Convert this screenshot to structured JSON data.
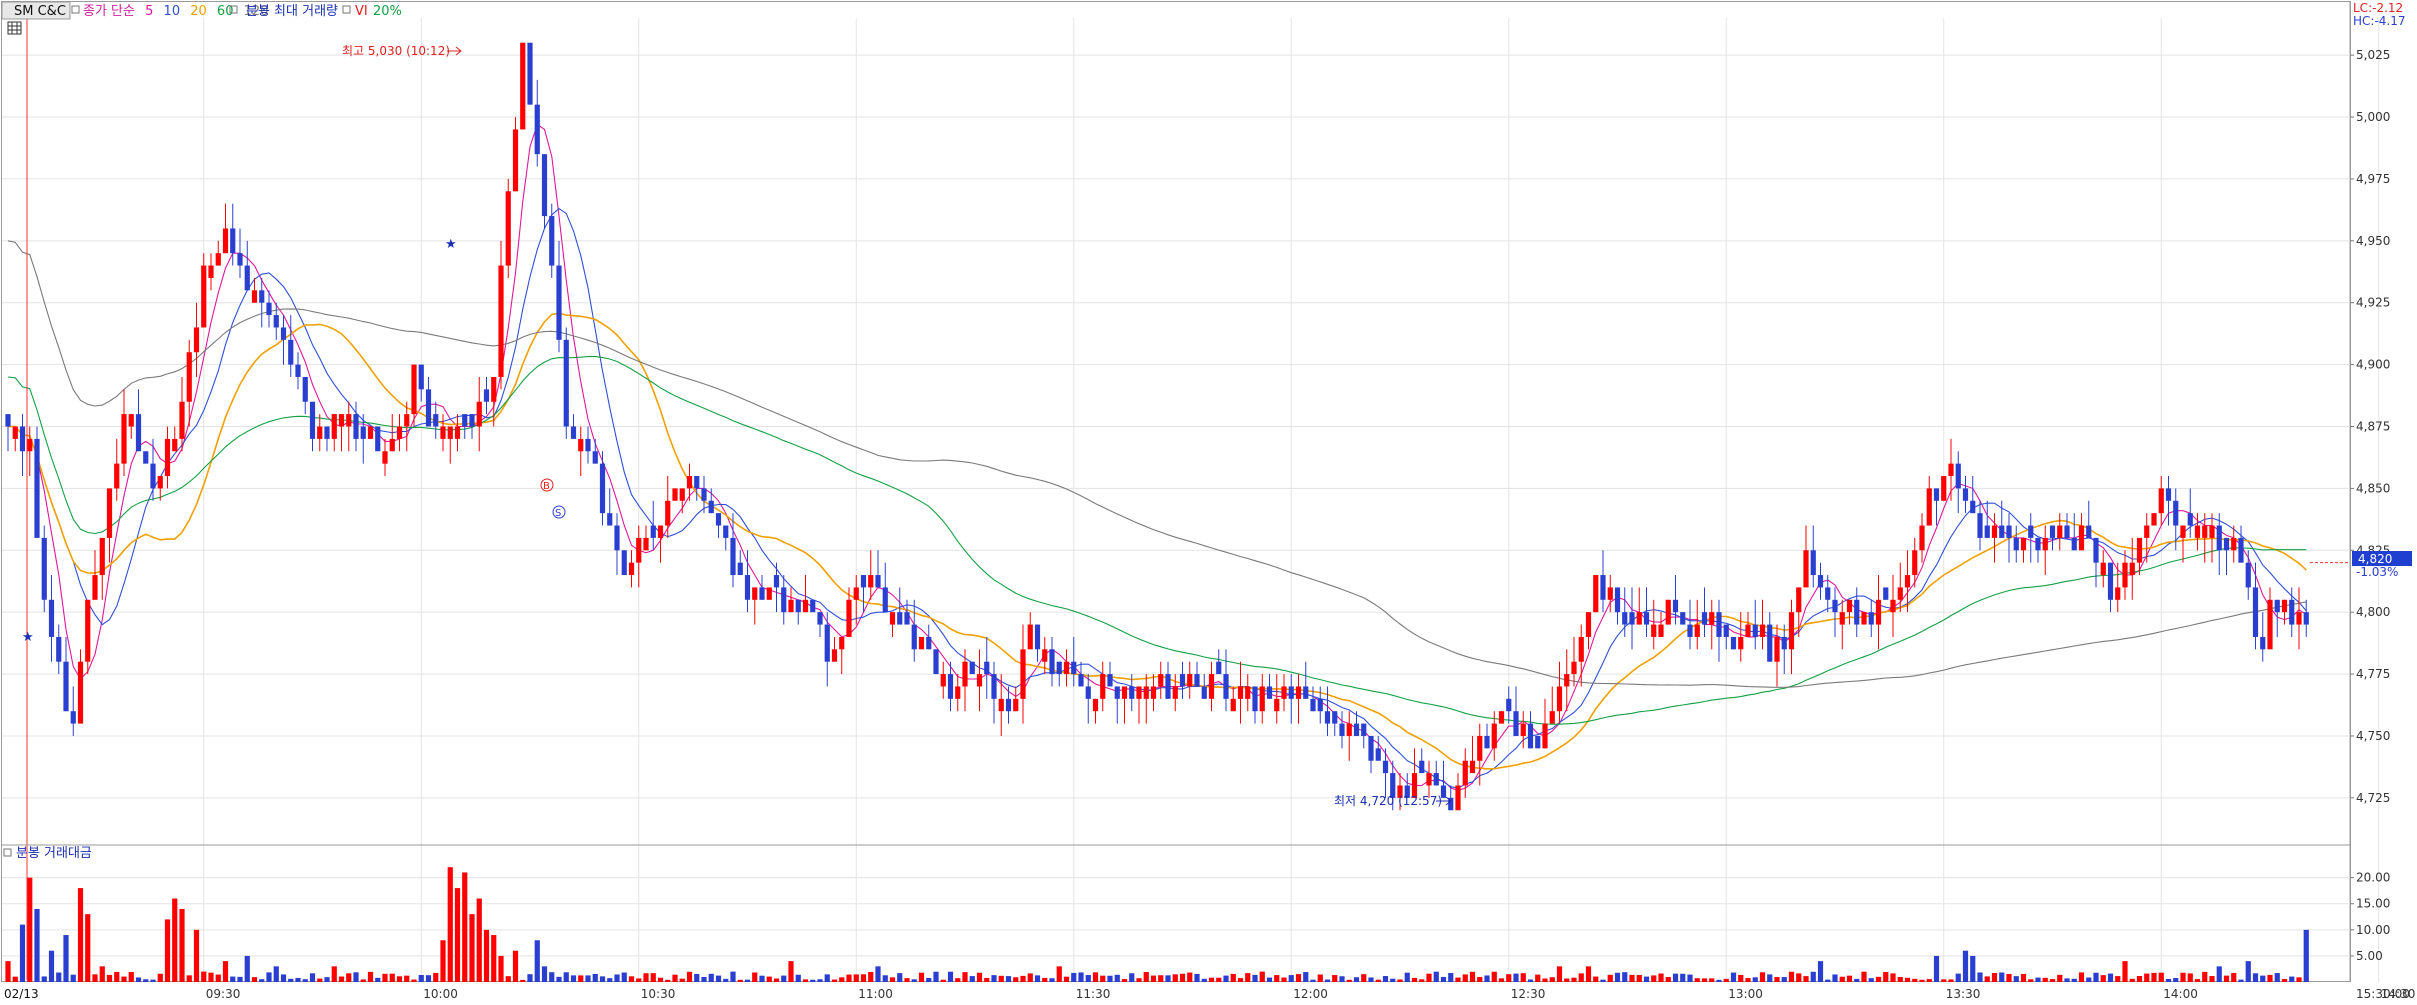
{
  "header": {
    "symbol": "SM C&C",
    "ma_label": "종가 단순",
    "ma_periods": [
      {
        "label": "5",
        "color": "#e0179c"
      },
      {
        "label": "10",
        "color": "#2f4fd8"
      },
      {
        "label": "20",
        "color": "#f0a000"
      },
      {
        "label": "60",
        "color": "#12a044"
      },
      {
        "label": "120",
        "color": "#7a7a7a"
      }
    ],
    "volume_label": "분봉 최대 거래량",
    "vi_label": "VI",
    "vi_value": "20%",
    "grid_icon": "grid-icon"
  },
  "corner": {
    "lc": "LC:-2.12",
    "hc": "HC:-4.17"
  },
  "current_price": {
    "price": "4,820",
    "change": "-1.03%"
  },
  "annotations": {
    "high": "최고 5,030 (10:12)",
    "low": "최저 4,720 (12:57)",
    "marker_b": "B",
    "marker_s": "S"
  },
  "volume_panel": {
    "title": "분봉 거래대금"
  },
  "chart_data": [
    {
      "type": "candlestick",
      "title": "SM C&C",
      "date": "02/13",
      "ylim": [
        4710,
        5040
      ],
      "yticks": [
        4725,
        4750,
        4775,
        4800,
        4825,
        4850,
        4875,
        4900,
        4925,
        4950,
        4975,
        5000,
        5025
      ],
      "ytick_labels": [
        "4,725",
        "4,750",
        "4,775",
        "4,800",
        "4,825",
        "4,850",
        "4,875",
        "4,900",
        "4,925",
        "4,950",
        "4,975",
        "5,000",
        "5,025"
      ],
      "xticks": [
        "09:30",
        "10:00",
        "10:30",
        "11:00",
        "11:30",
        "12:00",
        "12:30",
        "13:00",
        "13:30",
        "14:00",
        "14:30",
        "15:00",
        "15:30:00"
      ],
      "up_color": "#ff0000",
      "down_color": "#2a3fd0",
      "last_price": 4820,
      "high": {
        "value": 5030,
        "time": "10:12"
      },
      "low": {
        "value": 4720,
        "time": "12:57"
      },
      "moving_averages": [
        "5",
        "10",
        "20",
        "60",
        "120"
      ],
      "price_path": [
        [
          0,
          4875
        ],
        [
          3,
          4865
        ],
        [
          5,
          4800
        ],
        [
          9,
          4755
        ],
        [
          12,
          4820
        ],
        [
          16,
          4880
        ],
        [
          20,
          4855
        ],
        [
          24,
          4880
        ],
        [
          27,
          4940
        ],
        [
          30,
          4950
        ],
        [
          33,
          4925
        ],
        [
          38,
          4910
        ],
        [
          43,
          4870
        ],
        [
          47,
          4880
        ],
        [
          52,
          4860
        ],
        [
          56,
          4895
        ],
        [
          60,
          4870
        ],
        [
          64,
          4875
        ],
        [
          67,
          4900
        ],
        [
          69,
          4975
        ],
        [
          71,
          5030
        ],
        [
          74,
          4960
        ],
        [
          77,
          4880
        ],
        [
          80,
          4865
        ],
        [
          84,
          4820
        ],
        [
          88,
          4830
        ],
        [
          93,
          4855
        ],
        [
          97,
          4835
        ],
        [
          101,
          4815
        ],
        [
          105,
          4805
        ],
        [
          110,
          4805
        ],
        [
          114,
          4780
        ],
        [
          118,
          4815
        ],
        [
          122,
          4800
        ],
        [
          126,
          4785
        ],
        [
          130,
          4770
        ],
        [
          134,
          4775
        ],
        [
          138,
          4760
        ],
        [
          141,
          4795
        ],
        [
          145,
          4775
        ],
        [
          150,
          4770
        ],
        [
          155,
          4770
        ],
        [
          160,
          4770
        ],
        [
          165,
          4770
        ],
        [
          170,
          4765
        ],
        [
          175,
          4765
        ],
        [
          179,
          4765
        ],
        [
          183,
          4760
        ],
        [
          187,
          4745
        ],
        [
          191,
          4730
        ],
        [
          195,
          4730
        ],
        [
          199,
          4725
        ],
        [
          203,
          4745
        ],
        [
          207,
          4760
        ],
        [
          211,
          4745
        ],
        [
          215,
          4775
        ],
        [
          219,
          4810
        ],
        [
          223,
          4800
        ],
        [
          227,
          4800
        ],
        [
          231,
          4795
        ],
        [
          235,
          4795
        ],
        [
          240,
          4790
        ],
        [
          244,
          4785
        ],
        [
          248,
          4820
        ],
        [
          252,
          4800
        ],
        [
          256,
          4800
        ],
        [
          260,
          4805
        ],
        [
          264,
          4835
        ],
        [
          267,
          4860
        ],
        [
          270,
          4840
        ],
        [
          274,
          4830
        ],
        [
          278,
          4830
        ],
        [
          282,
          4830
        ],
        [
          286,
          4830
        ],
        [
          290,
          4810
        ],
        [
          294,
          4830
        ],
        [
          297,
          4845
        ],
        [
          301,
          4835
        ],
        [
          304,
          4830
        ],
        [
          308,
          4820
        ],
        [
          310,
          4790
        ],
        [
          313,
          4800
        ],
        [
          317,
          4800
        ]
      ]
    },
    {
      "type": "bar",
      "title": "분봉 거래대금",
      "ylim": [
        0,
        23
      ],
      "yticks": [
        5,
        10,
        15,
        20
      ],
      "ytick_labels": [
        "5.00",
        "10.00",
        "15.00",
        "20.00"
      ],
      "spikes": [
        [
          0,
          4
        ],
        [
          2,
          11
        ],
        [
          3,
          20
        ],
        [
          4,
          14
        ],
        [
          6,
          6
        ],
        [
          8,
          9
        ],
        [
          10,
          18
        ],
        [
          11,
          13
        ],
        [
          13,
          3
        ],
        [
          22,
          12
        ],
        [
          23,
          16
        ],
        [
          24,
          14
        ],
        [
          26,
          10
        ],
        [
          30,
          4
        ],
        [
          33,
          5
        ],
        [
          37,
          3
        ],
        [
          45,
          3
        ],
        [
          60,
          8
        ],
        [
          61,
          22
        ],
        [
          62,
          18
        ],
        [
          63,
          21
        ],
        [
          64,
          13
        ],
        [
          65,
          16
        ],
        [
          66,
          10
        ],
        [
          67,
          9
        ],
        [
          68,
          5
        ],
        [
          70,
          6
        ],
        [
          73,
          8
        ],
        [
          74,
          3
        ],
        [
          108,
          4
        ],
        [
          120,
          3
        ],
        [
          145,
          3
        ],
        [
          214,
          3
        ],
        [
          218,
          3
        ],
        [
          250,
          4
        ],
        [
          266,
          5
        ],
        [
          270,
          6
        ],
        [
          271,
          5
        ],
        [
          292,
          4
        ],
        [
          305,
          3
        ],
        [
          309,
          4
        ],
        [
          317,
          10
        ]
      ]
    }
  ]
}
